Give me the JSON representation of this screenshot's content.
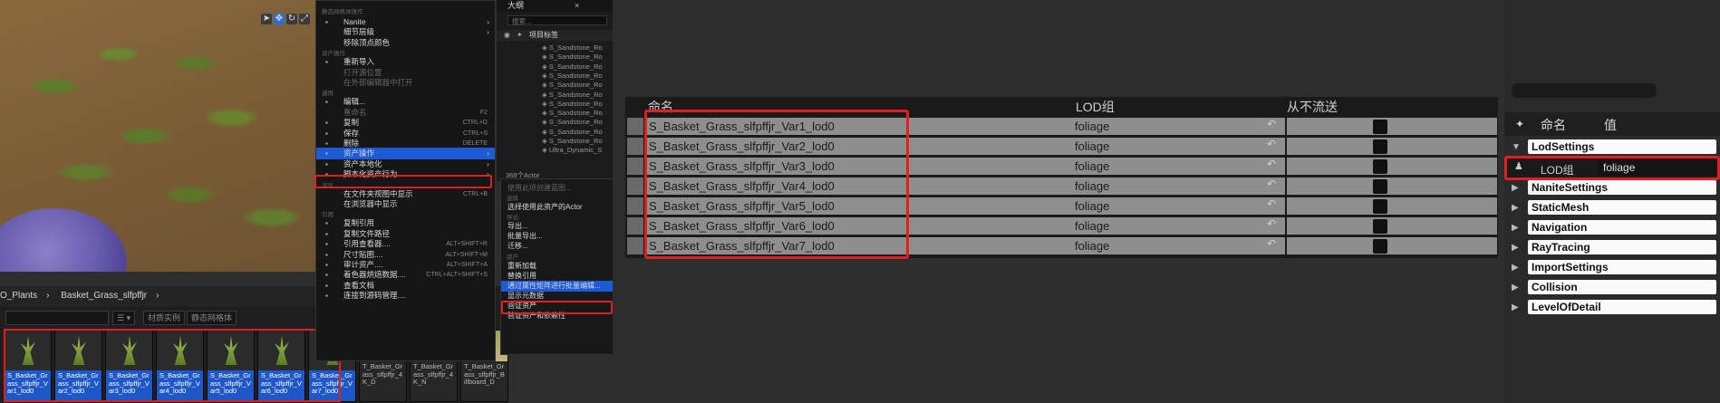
{
  "viewport": {
    "tool_icons": [
      "select-icon",
      "move-icon",
      "rotate-icon",
      "scale-icon"
    ]
  },
  "content_browser": {
    "breadcrumb": [
      "O_Plants",
      "Basket_Grass_slfpffjr"
    ],
    "filter_buttons": [
      "材质实例",
      "静态网格体"
    ],
    "items": [
      {
        "label": "S_Basket_Grass_slfpffjr_Var1_lod0",
        "type": "mesh"
      },
      {
        "label": "S_Basket_Grass_slfpffjr_Var2_lod0",
        "type": "mesh"
      },
      {
        "label": "S_Basket_Grass_slfpffjr_Var3_lod0",
        "type": "mesh"
      },
      {
        "label": "S_Basket_Grass_slfpffjr_Var4_lod0",
        "type": "mesh"
      },
      {
        "label": "S_Basket_Grass_slfpffjr_Var5_lod0",
        "type": "mesh"
      },
      {
        "label": "S_Basket_Grass_slfpffjr_Var6_lod0",
        "type": "mesh"
      },
      {
        "label": "S_Basket_Grass_slfpffjr_Var7_lod0",
        "type": "mesh"
      },
      {
        "label": "T_Basket_Grass_slfpffjr_4K_D",
        "type": "tex"
      },
      {
        "label": "T_Basket_Grass_slfpffjr_4K_N",
        "type": "tex"
      },
      {
        "label": "T_Basket_Grass_slfpffjr_Billboard_D",
        "type": "tex"
      }
    ]
  },
  "context_menu": {
    "header": "静态网格体操作",
    "items": [
      {
        "label": "Nanite",
        "icon": "nanite-icon",
        "arrow": true
      },
      {
        "label": "细节层级",
        "arrow": true
      },
      {
        "label": "移除顶点颜色"
      },
      {
        "section": "资产操作"
      },
      {
        "label": "重新导入",
        "icon": "reimport-icon"
      },
      {
        "label": "打开源位置",
        "disabled": true
      },
      {
        "label": "在外部编辑器中打开",
        "disabled": true
      },
      {
        "section": "通用"
      },
      {
        "label": "编辑...",
        "icon": "edit-icon"
      },
      {
        "label": "重命名",
        "shortcut": "F2",
        "disabled": true
      },
      {
        "label": "复制",
        "shortcut": "CTRL+D",
        "icon": "copy-icon"
      },
      {
        "label": "保存",
        "shortcut": "CTRL+S",
        "icon": "save-icon"
      },
      {
        "label": "删除",
        "shortcut": "DELETE",
        "icon": "delete-icon"
      },
      {
        "label": "资产操作",
        "arrow": true,
        "highlight": true,
        "icon": "asset-actions-icon"
      },
      {
        "label": "资产本地化",
        "arrow": true,
        "icon": "localize-icon"
      },
      {
        "label": "脚本化资产行为",
        "arrow": true,
        "icon": "script-icon"
      },
      {
        "section": "浏览"
      },
      {
        "label": "在文件夹视图中显示",
        "shortcut": "CTRL+B"
      },
      {
        "label": "在浏览器中显示"
      },
      {
        "section": "引用"
      },
      {
        "label": "复制引用",
        "icon": "copy-ref-icon"
      },
      {
        "label": "复制文件路径",
        "icon": "copy-path-icon"
      },
      {
        "label": "引用查看器....",
        "shortcut": "ALT+SHIFT+R",
        "icon": "ref-viewer-icon"
      },
      {
        "label": "尺寸贴图....",
        "shortcut": "ALT+SHIFT+M",
        "icon": "size-map-icon"
      },
      {
        "label": "审计资产....",
        "shortcut": "ALT+SHIFT+A",
        "icon": "audit-icon"
      },
      {
        "label": "着色器烘焙数据....",
        "shortcut": "CTRL+ALT+SHIFT+S",
        "icon": "shader-icon"
      },
      {
        "label": "查看文档",
        "icon": "docs-icon"
      },
      {
        "label": "连接到源码管理....",
        "icon": "source-control-icon"
      }
    ]
  },
  "outliner": {
    "tab": "大纲",
    "search_placeholder": "搜索...",
    "column": "项目标签",
    "items": [
      "S_Sandstone_Ro",
      "S_Sandstone_Ro",
      "S_Sandstone_Ro",
      "S_Sandstone_Ro",
      "S_Sandstone_Ro",
      "S_Sandstone_Ro",
      "S_Sandstone_Ro",
      "S_Sandstone_Ro",
      "S_Sandstone_Ro",
      "S_Sandstone_Ro",
      "S_Sandstone_Ro",
      "Ultra_Dynamic_S"
    ],
    "count": "368个Actor"
  },
  "submenu": {
    "items": [
      {
        "label": "使用此项创建蓝图...",
        "disabled": true
      },
      {
        "section": "选择"
      },
      {
        "label": "选择使用此资产的Actor"
      },
      {
        "section": "导出"
      },
      {
        "label": "导出..."
      },
      {
        "label": "批量导出..."
      },
      {
        "label": "迁移..."
      },
      {
        "section": "资产"
      },
      {
        "label": "重新加载"
      },
      {
        "label": "替换引用"
      },
      {
        "label": "通过属性矩阵进行批量编辑...",
        "highlight": true
      },
      {
        "label": "显示元数据"
      },
      {
        "label": "验证资产"
      },
      {
        "label": "验证资产和依赖性"
      }
    ]
  },
  "property_matrix": {
    "columns": [
      "命名",
      "LOD组",
      "从不流送"
    ],
    "rows": [
      {
        "name": "S_Basket_Grass_slfpffjr_Var1_lod0",
        "lod_group": "foliage"
      },
      {
        "name": "S_Basket_Grass_slfpffjr_Var2_lod0",
        "lod_group": "foliage"
      },
      {
        "name": "S_Basket_Grass_slfpffjr_Var3_lod0",
        "lod_group": "foliage"
      },
      {
        "name": "S_Basket_Grass_slfpffjr_Var4_lod0",
        "lod_group": "foliage"
      },
      {
        "name": "S_Basket_Grass_slfpffjr_Var5_lod0",
        "lod_group": "foliage"
      },
      {
        "name": "S_Basket_Grass_slfpffjr_Var6_lod0",
        "lod_group": "foliage"
      },
      {
        "name": "S_Basket_Grass_slfpffjr_Var7_lod0",
        "lod_group": "foliage"
      }
    ]
  },
  "details": {
    "col_name": "命名",
    "col_value": "值",
    "lod_label": "LOD组",
    "lod_value": "foliage",
    "categories": [
      "LodSettings",
      "NaniteSettings",
      "StaticMesh",
      "Navigation",
      "RayTracing",
      "ImportSettings",
      "Collision",
      "LevelOfDetail"
    ]
  }
}
